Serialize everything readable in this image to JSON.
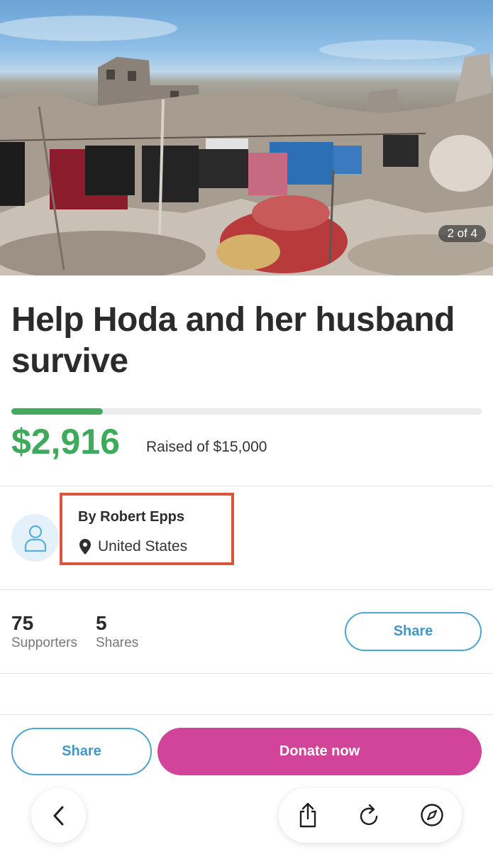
{
  "hero": {
    "image_description_icon": "rubble-photo",
    "counter": "2 of 4"
  },
  "campaign": {
    "title": "Help Hoda and her husband survive",
    "raised_amount": "$2,916",
    "raised_label": "Raised of $15,000",
    "progress_fraction": 0.194,
    "accent_green": "#3daa5c"
  },
  "organizer": {
    "name": "By Robert Epps",
    "location": "United States",
    "avatar_icon": "user-icon",
    "location_icon": "location-pin-icon"
  },
  "stats": {
    "supporters_count": "75",
    "supporters_label": "Supporters",
    "shares_count": "5",
    "shares_label": "Shares",
    "share_button": "Share"
  },
  "actions": {
    "share_label": "Share",
    "donate_label": "Donate now",
    "donate_color": "#d2449a"
  },
  "browser_toolbar": {
    "back_icon": "chevron-left-icon",
    "share_icon": "share-icon",
    "reload_icon": "reload-icon",
    "compass_icon": "compass-icon"
  }
}
